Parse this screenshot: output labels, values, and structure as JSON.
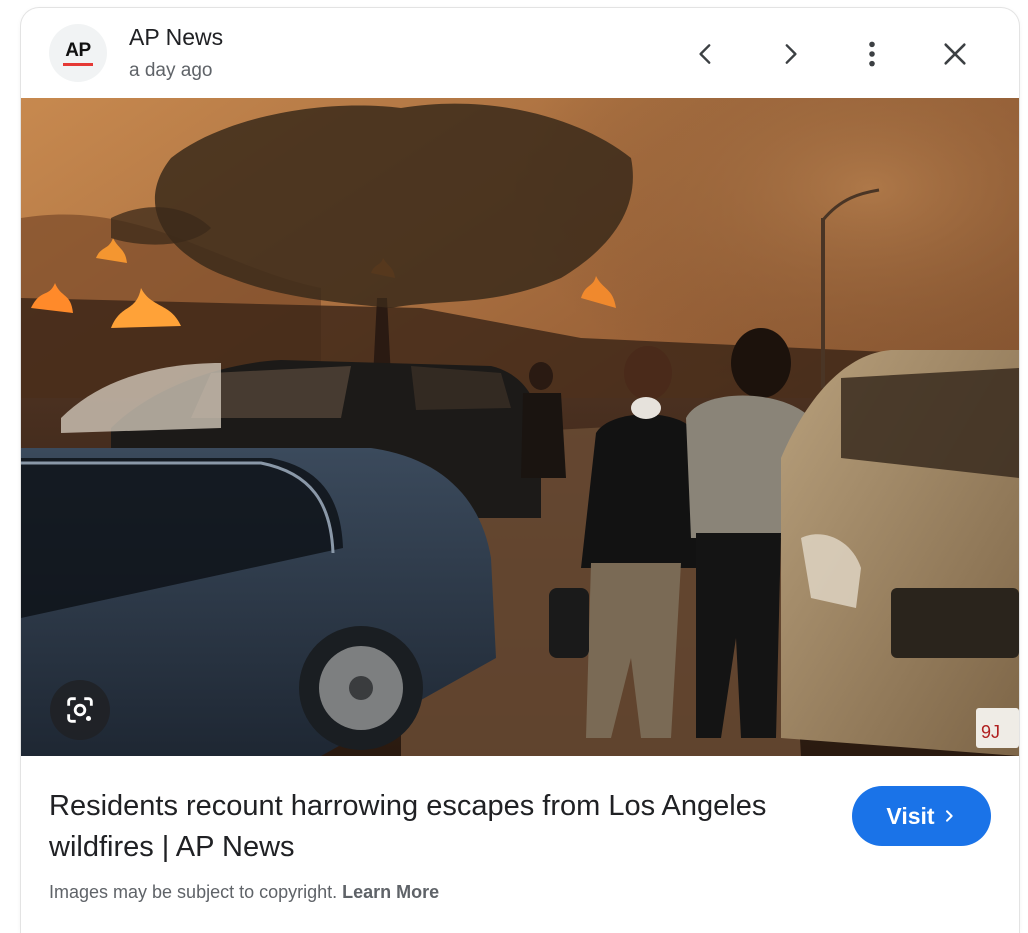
{
  "header": {
    "logo_text": "AP",
    "source_name": "AP News",
    "timestamp": "a day ago"
  },
  "icons": {
    "prev": "chevron-left-icon",
    "next": "chevron-right-icon",
    "more": "more-vert-icon",
    "close": "close-icon",
    "lens": "lens-search-icon"
  },
  "content": {
    "title": "Residents recount harrowing escapes from Los Angeles wildfires | AP News",
    "visit_label": "Visit",
    "disclaimer": "Images may be subject to copyright.",
    "learn_more": "Learn More"
  },
  "colors": {
    "accent": "#1a73e8",
    "logo_red": "#e53935"
  }
}
